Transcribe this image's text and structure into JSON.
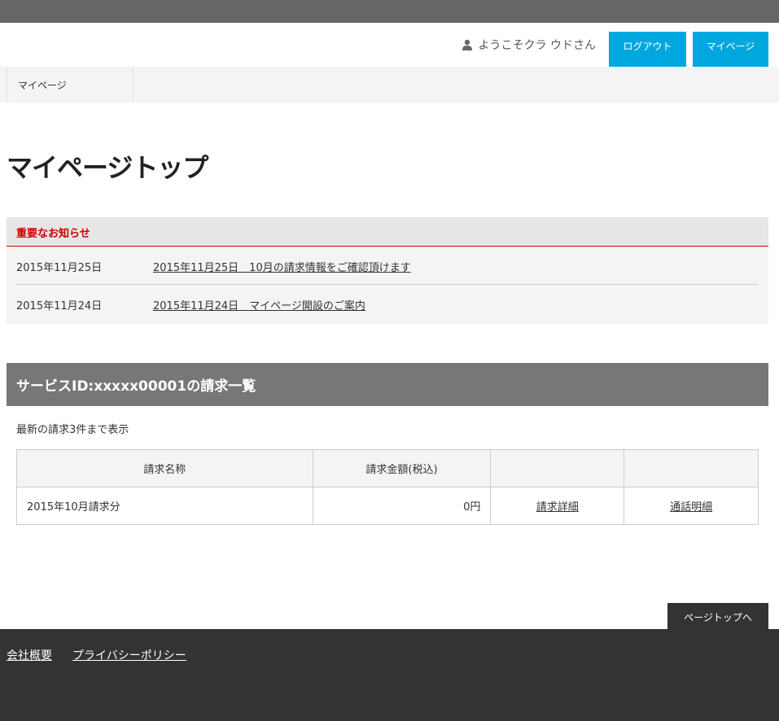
{
  "header": {
    "welcome_text": "ようこそクラ ウドさん",
    "logout_label": "ログアウト",
    "mypage_label": "マイページ"
  },
  "breadcrumb": {
    "current": "マイページ"
  },
  "page": {
    "title": "マイページトップ"
  },
  "notices": {
    "heading": "重要なお知らせ",
    "items": [
      {
        "date": "2015年11月25日",
        "link": "2015年11月25日　10月の請求情報をご確認頂けます"
      },
      {
        "date": "2015年11月24日",
        "link": "2015年11月24日　マイページ開設のご案内"
      }
    ]
  },
  "service": {
    "heading": "サービスID:xxxxx00001の請求一覧",
    "note": "最新の請求3件まで表示",
    "table": {
      "headers": [
        "請求名称",
        "請求金額(税込)",
        "",
        ""
      ],
      "rows": [
        {
          "name": "2015年10月請求分",
          "amount": "0円",
          "detail_link": "請求詳細",
          "call_link": "通話明細"
        }
      ]
    }
  },
  "pagetop_label": "ページトップへ",
  "footer": {
    "company_link": "会社概要",
    "privacy_link": "プライバシーポリシー"
  },
  "colors": {
    "accent": "#00a7de",
    "notice_red": "#cc0000",
    "footer_bg": "#333333",
    "section_header_bg": "#777777"
  },
  "icons": {
    "user": "user-icon"
  }
}
